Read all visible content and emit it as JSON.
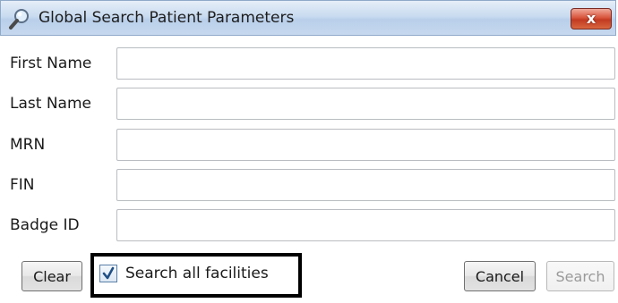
{
  "window": {
    "title": "Global Search Patient Parameters",
    "title_icon": "magnifier-icon",
    "close_label": "x"
  },
  "fields": [
    {
      "label": "First Name",
      "value": "",
      "placeholder": ""
    },
    {
      "label": "Last Name",
      "value": "",
      "placeholder": ""
    },
    {
      "label": "MRN",
      "value": "",
      "placeholder": ""
    },
    {
      "label": "FIN",
      "value": "",
      "placeholder": ""
    },
    {
      "label": "Badge ID",
      "value": "",
      "placeholder": ""
    }
  ],
  "actions": {
    "clear_label": "Clear",
    "search_all_label": "Search all facilities",
    "search_all_checked": true,
    "cancel_label": "Cancel",
    "search_label": "Search",
    "search_enabled": false
  },
  "colors": {
    "close_button": "#c23a22",
    "titlebar": "#c9dbf0",
    "highlight_border": "#000000"
  }
}
